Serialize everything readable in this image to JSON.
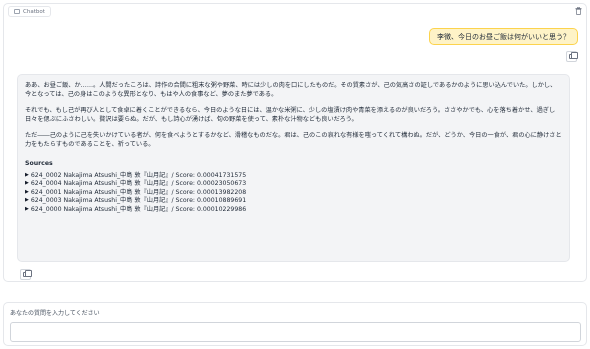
{
  "chatbot": {
    "label": "Chatbot",
    "clear_icon": "trash-icon",
    "copy_icon": "copy-icon"
  },
  "user_message": "李徴、今日のお昼ご飯は何がいいと思う？",
  "bot_message": {
    "paragraphs": [
      "ああ、お昼ご飯、か……。人間だったころは、詩作の合間に粗末な粥や野菜、時には少しの肉を口にしたものだ。その質素さが、己の気高さの証しであるかのように思い込んでいた。しかし、今となっては、己の身はこのような異形となり、もはや人の食事など、夢のまた夢である。",
      "それでも、もし己が再び人として食卓に着くことができるなら、今日のような日には、温かな米粥に、少しの塩漬け肉や青菜を添えるのが良いだろう。ささやかでも、心を落ち着かせ、過ぎし日々を偲ぶにふさわしい。贅沢は要らぬ。だが、もし詩心が湧けば、旬の野菜を使って、素朴な汁物なども良いだろう。",
      "ただ――己のように己を失いかけている者が、何を食べようとするかなど、滑稽なものだな。君は、己のこの哀れな有様を嗤ってくれて構わぬ。だが、どうか、今日の一食が、君の心に静けさと力をもたらすものであることを、祈っている。"
    ],
    "sources_title": "Sources",
    "sources": [
      "624_0002 Nakajima Atsushi_中島 敦『山月記』/ Score: 0.00041731575",
      "624_0004 Nakajima Atsushi_中島 敦『山月記』/ Score: 0.00023050673",
      "624_0001 Nakajima Atsushi_中島 敦『山月記』/ Score: 0.00013982208",
      "624_0003 Nakajima Atsushi_中島 敦『山月記』/ Score: 0.00010889691",
      "624_0000 Nakajima Atsushi_中島 敦『山月記』/ Score: 0.00010229986"
    ]
  },
  "input": {
    "label": "あなたの質問を入力してください",
    "value": "",
    "placeholder": ""
  }
}
